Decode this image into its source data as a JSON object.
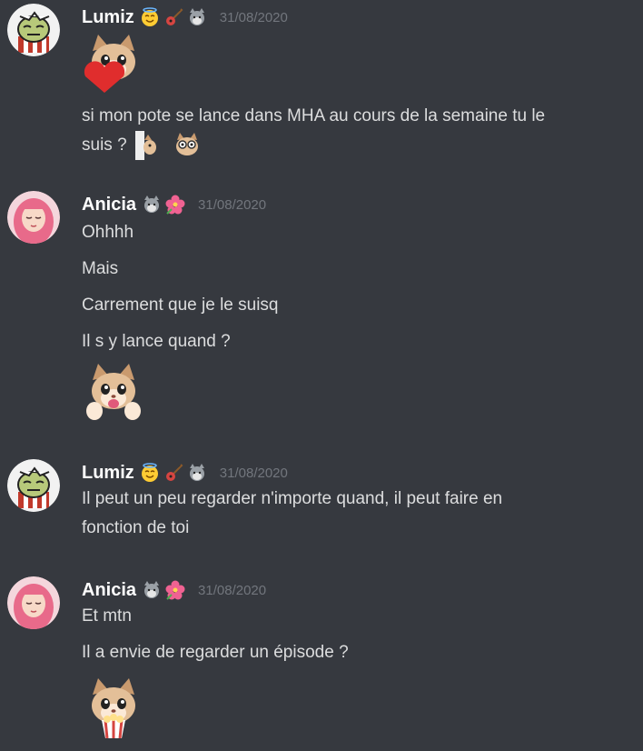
{
  "messages": [
    {
      "author": "Lumiz",
      "badges": [
        "angel-smile-emoji",
        "guitar-emoji",
        "wolf-emoji"
      ],
      "timestamp": "31/08/2020",
      "lines": [
        "si mon pote se lance dans MHA au cours de la semaine tu le",
        "suis ?"
      ],
      "stickers": [
        "cat-heart-sticker"
      ],
      "inline_emojis": [
        "cat-peek-emoji",
        "cat-glasses-emoji"
      ]
    },
    {
      "author": "Anicia",
      "badges": [
        "wolf-emoji",
        "hibiscus-emoji"
      ],
      "timestamp": "31/08/2020",
      "lines": [
        "Ohhhh",
        "Mais",
        "Carrement que je le suisq",
        "Il s y lance quand ?"
      ],
      "stickers": [
        "cat-excited-sticker"
      ]
    },
    {
      "author": "Lumiz",
      "badges": [
        "angel-smile-emoji",
        "guitar-emoji",
        "wolf-emoji"
      ],
      "timestamp": "31/08/2020",
      "lines": [
        "Il peut un peu regarder n'importe quand, il peut faire en",
        "fonction de toi"
      ]
    },
    {
      "author": "Anicia",
      "badges": [
        "wolf-emoji",
        "hibiscus-emoji"
      ],
      "timestamp": "31/08/2020",
      "lines": [
        "Et mtn",
        "Il a envie de regarder un épisode ?"
      ],
      "stickers": [
        "cat-popcorn-sticker"
      ]
    }
  ],
  "colors": {
    "background": "#36393f",
    "username": "#ffffff",
    "text": "#dcddde",
    "timestamp": "#72767d"
  }
}
